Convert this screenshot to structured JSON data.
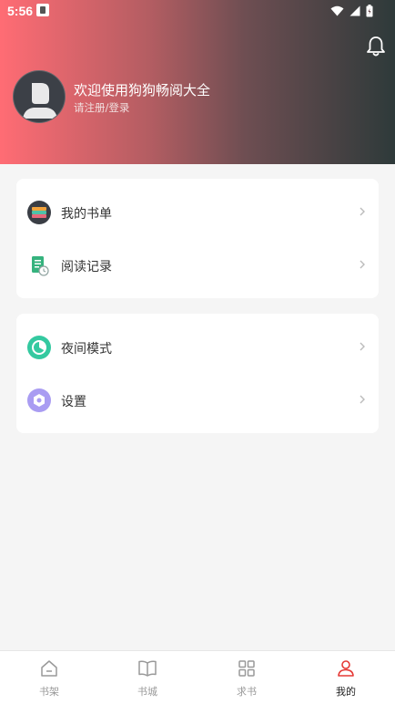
{
  "status_bar": {
    "time": "5:56",
    "icons": [
      "app-notification-icon",
      "wifi-icon",
      "cellular-signal-icon",
      "battery-icon"
    ]
  },
  "header": {
    "welcome_text": "欢迎使用狗狗畅阅大全",
    "login_link": "请注册/登录",
    "bell_icon": "bell-icon",
    "gradient_colors": [
      "#ff6c74",
      "#2e3a3a"
    ]
  },
  "menu_groups": [
    {
      "items": [
        {
          "label": "我的书单",
          "icon": "book-list-icon"
        },
        {
          "label": "阅读记录",
          "icon": "reading-history-icon"
        }
      ]
    },
    {
      "items": [
        {
          "label": "夜间模式",
          "icon": "night-mode-icon"
        },
        {
          "label": "设置",
          "icon": "settings-icon"
        }
      ]
    }
  ],
  "tabbar": {
    "active_color": "#e53935",
    "tabs": [
      {
        "label": "书架",
        "icon": "bookshelf-icon"
      },
      {
        "label": "书城",
        "icon": "open-book-icon"
      },
      {
        "label": "求书",
        "icon": "grid-icon"
      },
      {
        "label": "我的",
        "icon": "user-icon",
        "active": true
      }
    ]
  }
}
